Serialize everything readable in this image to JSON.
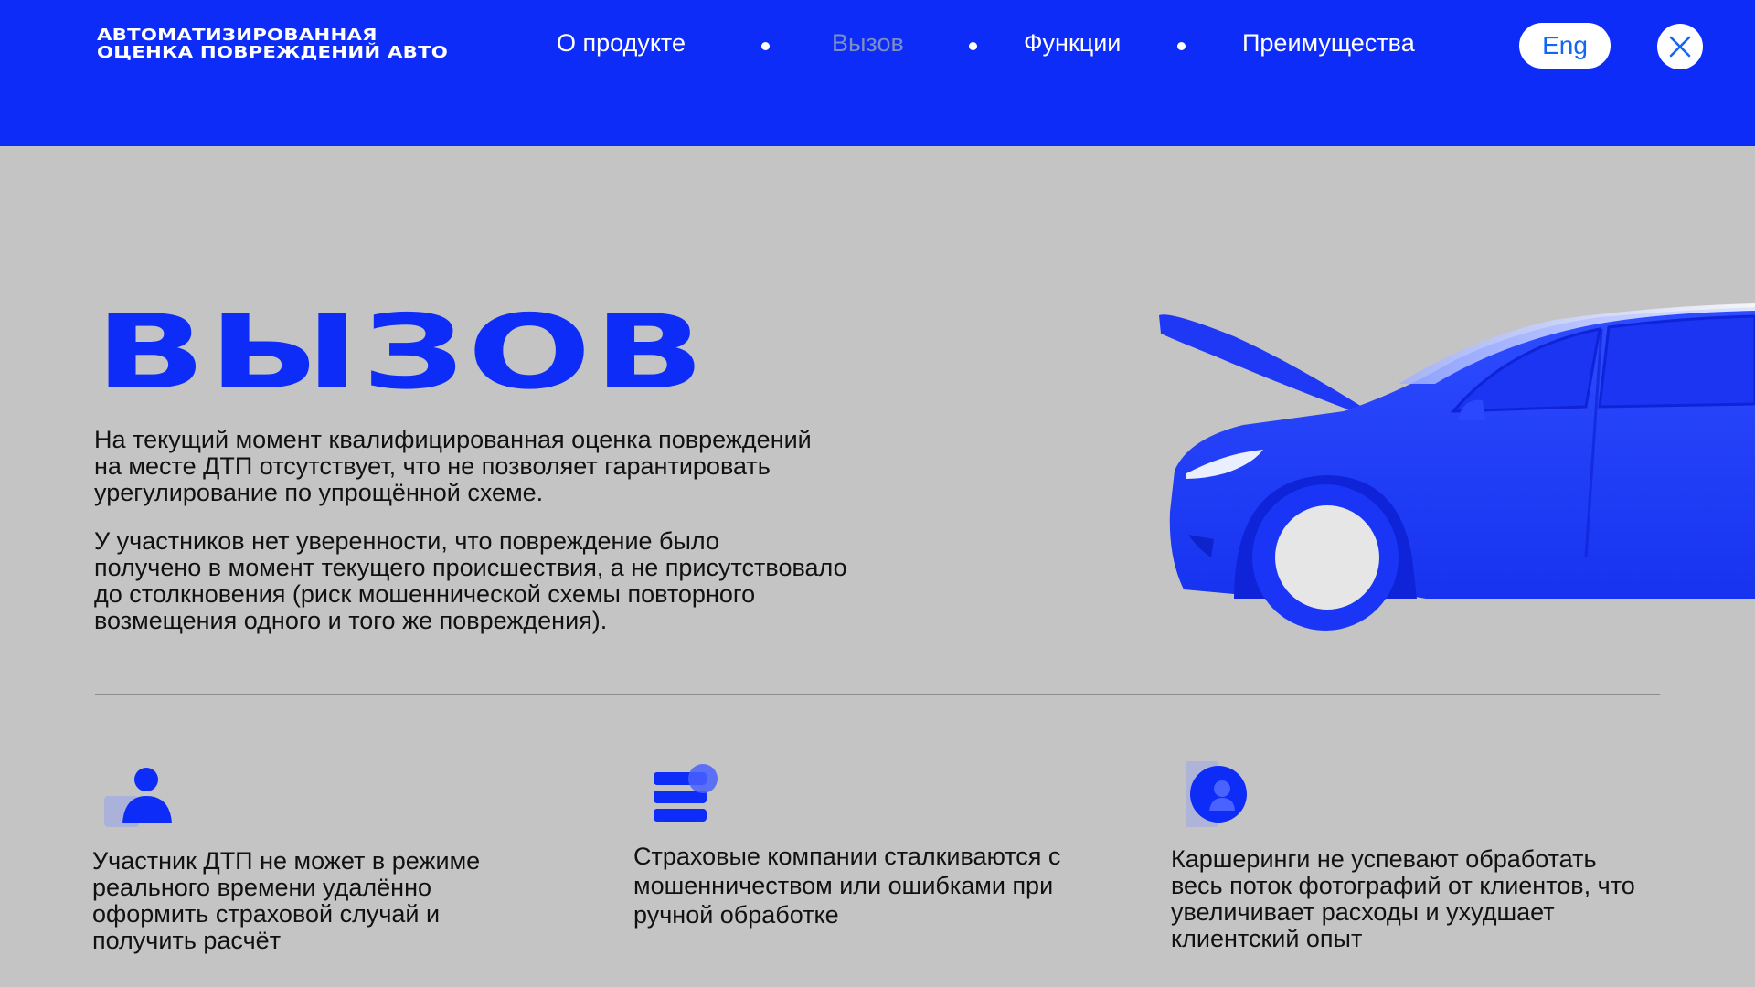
{
  "header": {
    "brand_line1": "АВТОМАТИЗИРОВАННАЯ",
    "brand_line2": "ОЦЕНКА ПОВРЕЖДЕНИЙ АВТО",
    "nav": [
      {
        "label": "О продукте"
      },
      {
        "label": "Вызов"
      },
      {
        "label": "Функции"
      },
      {
        "label": "Преимущества"
      }
    ],
    "lang_label": "Eng",
    "close_icon": "close-icon"
  },
  "hero": {
    "title": "ВЫЗОВ",
    "paragraph1": [
      "На текущий момент квалифицированная оценка повреждений",
      "на месте ДТП отсутствует, что не позволяет гарантировать",
      "урегулирование по упрощённой схеме."
    ],
    "paragraph2": [
      "У участников нет уверенности, что повреждение было",
      "получено в момент текущего происшествия, а не присутствовало",
      "до столкновения (риск мошеннической схемы повторного",
      "возмещения одного и того же повреждения)."
    ],
    "image": "car-open-hood-illustration"
  },
  "features": [
    {
      "icon": "user-icon",
      "lines": [
        "Участник ДТП не может в режиме",
        "реального времени удалённо",
        "оформить страховой случай и",
        "получить расчёт"
      ]
    },
    {
      "icon": "list-icon",
      "lines": [
        "Страховые компании сталкиваются с",
        "мошенничеством или ошибками при",
        "ручной обработке"
      ]
    },
    {
      "icon": "profile-circle-icon",
      "lines": [
        "Каршеринги не успевают обработать",
        "весь поток фотографий от клиентов, что",
        "увеличивает расходы и ухудшает",
        "клиентский опыт"
      ]
    }
  ],
  "colors": {
    "accent": "#0d2cf8",
    "background": "#c4c4c4",
    "nav_active": "#7d8fc0",
    "lang_text": "#1466f0"
  }
}
